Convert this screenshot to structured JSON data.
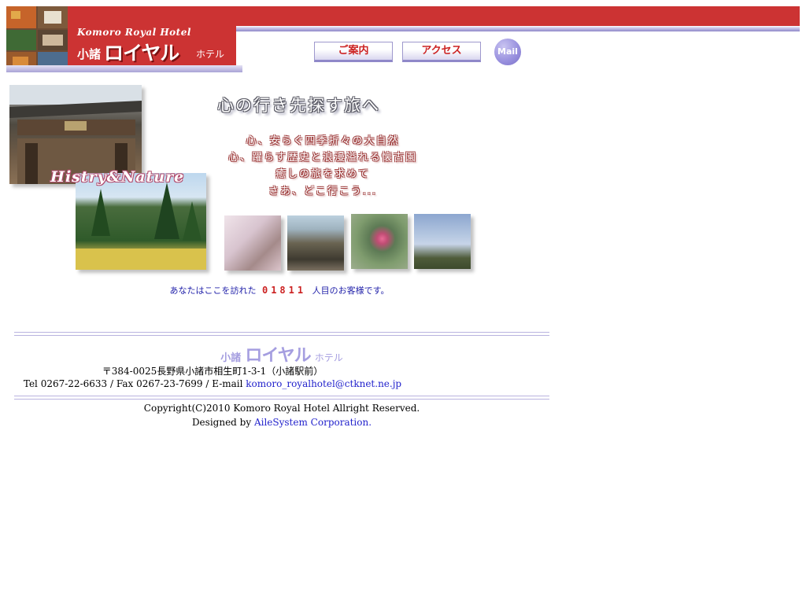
{
  "header": {
    "logo_en": "Komoro Royal Hotel",
    "logo_small": "小諸",
    "logo_big": "ロイヤル",
    "logo_hotel": "ホテル"
  },
  "nav": {
    "guide_label": "ご案内",
    "access_label": "アクセス",
    "mail_label": "Mail"
  },
  "hero": {
    "script_text": "Histry&Nature",
    "tagline": "心の行き先探す旅へ",
    "poem": [
      "心、安らぐ四季折々の大自然",
      "心、躍らす歴史と浪漫溢れる懐古園",
      "癒しの旅を求めて",
      "さあ、どこ行こう..."
    ]
  },
  "counter": {
    "before": "あなたはここを訪れた",
    "digits": "01811",
    "after": "人目のお客様です。"
  },
  "footer": {
    "logo_small": "小諸",
    "logo_big": "ロイヤル",
    "logo_hotel": "ホテル",
    "address": "〒384-0025長野県小諸市相生町1-3-1（小諸駅前）",
    "contact_prefix": "Tel 0267-22-6633 / Fax 0267-23-7699 / E-mail ",
    "email": "komoro_royalhotel@ctknet.ne.jp",
    "copyright": "Copyright(C)2010 Komoro Royal Hotel Allright Reserved.",
    "designed_prefix": "Designed by ",
    "designer": "AileSystem Corporation."
  },
  "colors": {
    "brand_red": "#cc3333",
    "accent_lavender": "#a59ee0",
    "link_blue": "#2222cc"
  }
}
